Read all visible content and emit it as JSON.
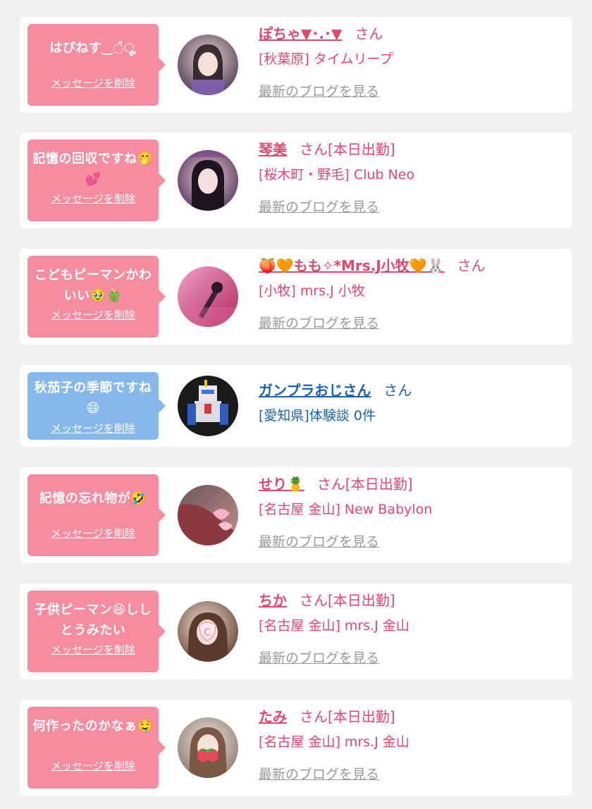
{
  "suffix_san": "さん",
  "suffix_san_work": "さん[本日出勤]",
  "blog_link": "最新のブログを見る",
  "delete_link": "メッセージを削除",
  "colors": {
    "pink_bubble": "#f58ca0",
    "blue_bubble": "#86b8ec",
    "pink_text": "#e2476f",
    "blue_text": "#1b62a8",
    "muted": "#999999"
  },
  "items": [
    {
      "message": "はぴねす‿◌̊ೄ",
      "name": "ぽちゃ▼･.･▼",
      "suffix": "さん",
      "shop": "[秋葉原] タイムリープ",
      "blog": "最新のブログを見る",
      "bubble": "pink"
    },
    {
      "message": "記憶の回収ですね🤭💕",
      "name": "琴美",
      "suffix": "さん[本日出勤]",
      "shop": "[桜木町・野毛] Club Neo",
      "blog": "最新のブログを見る",
      "bubble": "pink"
    },
    {
      "message": "こどもピーマンかわいい🥹🫑",
      "name": "🍑🧡もも✧*Mrs.J小牧🧡🐰",
      "suffix": "さん",
      "shop": "[小牧] mrs.J 小牧",
      "blog": "最新のブログを見る",
      "bubble": "pink"
    },
    {
      "message": "秋茄子の季節ですね😄",
      "name": "ガンプラおじさん",
      "suffix": "さん",
      "shop": "[愛知県]体験談 0件",
      "blog": "",
      "bubble": "blue"
    },
    {
      "message": "記憶の忘れ物が🤣",
      "name": "せり🍍",
      "suffix": "さん[本日出勤]",
      "shop": "[名古屋 金山] New Babylon",
      "blog": "最新のブログを見る",
      "bubble": "pink"
    },
    {
      "message": "子供ピーマン😆ししとうみたい",
      "name": "ちか",
      "suffix": "さん[本日出勤]",
      "shop": "[名古屋 金山] mrs.J 金山",
      "blog": "最新のブログを見る",
      "bubble": "pink"
    },
    {
      "message": "何作ったのかなぁ🤤",
      "name": "たみ",
      "suffix": "さん[本日出勤]",
      "shop": "[名古屋 金山] mrs.J 金山",
      "blog": "最新のブログを見る",
      "bubble": "pink"
    }
  ]
}
